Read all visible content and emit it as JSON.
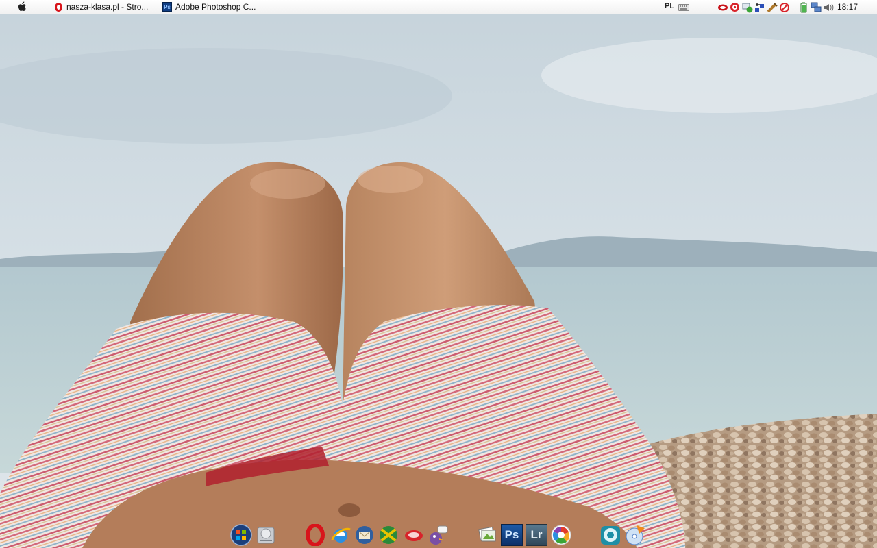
{
  "menubar": {
    "apple_icon": "apple-icon",
    "tasks": [
      {
        "label": "nasza-klasa.pl - Stro...",
        "icon": "opera-icon"
      },
      {
        "label": "Adobe Photoshop C...",
        "icon": "photoshop-icon"
      }
    ],
    "language": "PL",
    "clock": "18:17",
    "tray_icons": [
      "hardware-icon",
      "antivirus-icon",
      "network-globe-icon",
      "usb-devices-icon",
      "tools-icon",
      "blocked-icon",
      "battery-icon",
      "network-connection-icon",
      "volume-icon"
    ]
  },
  "dock": {
    "items": [
      {
        "name": "windows-start-icon"
      },
      {
        "name": "hard-drive-icon"
      },
      {
        "name": "opera-browser-icon"
      },
      {
        "name": "internet-explorer-icon"
      },
      {
        "name": "thunderbird-icon"
      },
      {
        "name": "jabber-icon"
      },
      {
        "name": "cloud-messenger-icon"
      },
      {
        "name": "pidgin-chat-icon"
      },
      {
        "name": "image-viewer-icon"
      },
      {
        "name": "photoshop-icon",
        "label": "Ps"
      },
      {
        "name": "lightroom-icon",
        "label": "Lr"
      },
      {
        "name": "picasa-icon"
      },
      {
        "name": "media-player-icon"
      },
      {
        "name": "dvd-burner-icon"
      }
    ]
  }
}
